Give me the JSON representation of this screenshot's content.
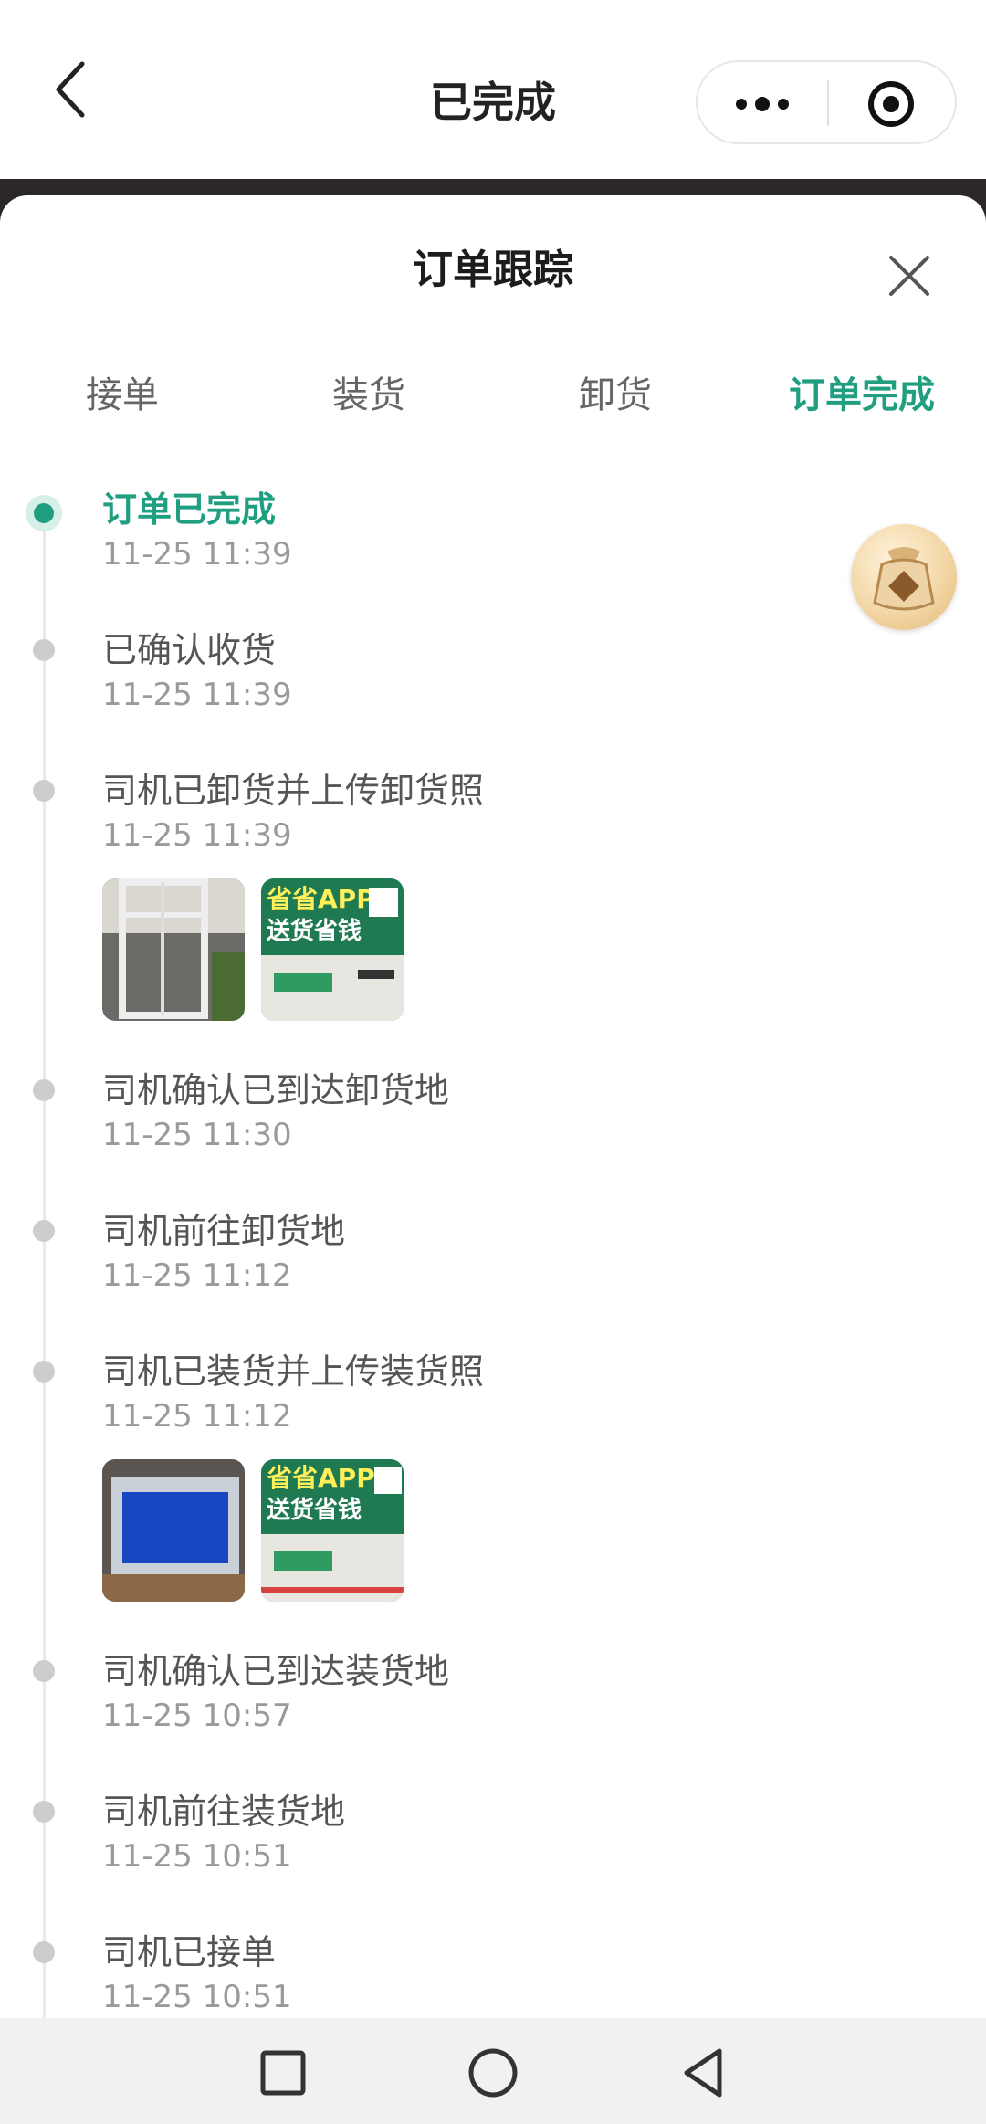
{
  "header": {
    "title": "已完成"
  },
  "sheet": {
    "title": "订单跟踪",
    "tabs": [
      {
        "label": "接单",
        "active": false
      },
      {
        "label": "装货",
        "active": false
      },
      {
        "label": "卸货",
        "active": false
      },
      {
        "label": "订单完成",
        "active": true
      }
    ]
  },
  "timeline": [
    {
      "title": "订单已完成",
      "time": "11-25 11:39",
      "active": true
    },
    {
      "title": "已确认收货",
      "time": "11-25 11:39"
    },
    {
      "title": "司机已卸货并上传卸货照",
      "time": "11-25 11:39",
      "photos": 2
    },
    {
      "title": "司机确认已到达卸货地",
      "time": "11-25 11:30"
    },
    {
      "title": "司机前往卸货地",
      "time": "11-25 11:12"
    },
    {
      "title": "司机已装货并上传装货照",
      "time": "11-25 11:12",
      "photos": 2
    },
    {
      "title": "司机确认已到达装货地",
      "time": "11-25 10:57"
    },
    {
      "title": "司机前往装货地",
      "time": "11-25 10:51"
    },
    {
      "title": "司机已接单",
      "time": "11-25 10:51"
    }
  ],
  "photo_banner": {
    "line1": "省省APP",
    "line2": "送货省钱"
  },
  "colors": {
    "accent": "#1f9e80",
    "dot": "#cdcdcd"
  }
}
